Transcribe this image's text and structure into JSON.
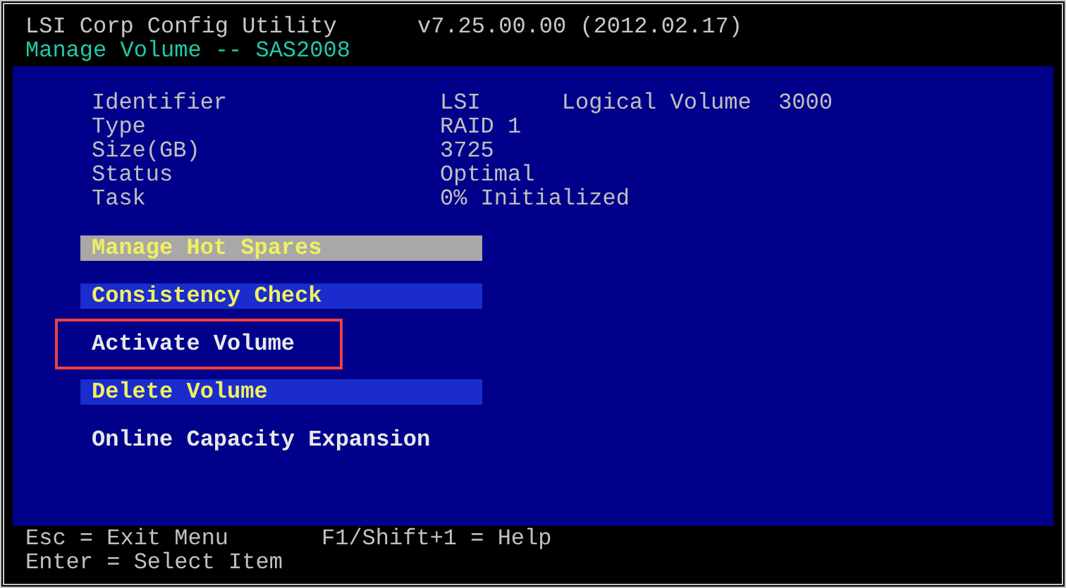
{
  "header": {
    "title": "LSI Corp Config Utility",
    "version": "v7.25.00.00 (2012.02.17)",
    "subtitle": "Manage Volume -- SAS2008"
  },
  "properties": [
    {
      "label": "Identifier",
      "value": "LSI      Logical Volume  3000"
    },
    {
      "label": "Type",
      "value": "RAID 1"
    },
    {
      "label": "Size(GB)",
      "value": "3725"
    },
    {
      "label": "Status",
      "value": "Optimal"
    },
    {
      "label": "Task",
      "value": "0% Initialized"
    }
  ],
  "menu": [
    {
      "label": "Manage Hot Spares",
      "kind": "bar",
      "selected": true,
      "annotated": false
    },
    {
      "label": "Consistency Check",
      "kind": "bar",
      "selected": false,
      "annotated": false
    },
    {
      "label": "Activate Volume",
      "kind": "plain",
      "selected": false,
      "annotated": true
    },
    {
      "label": "Delete Volume",
      "kind": "bar",
      "selected": false,
      "annotated": false
    },
    {
      "label": "Online Capacity Expansion",
      "kind": "plain",
      "selected": false,
      "annotated": false
    }
  ],
  "footer": [
    {
      "key": "Esc = Exit Menu",
      "help": "F1/Shift+1 = Help"
    },
    {
      "key": "Enter = Select Item"
    }
  ]
}
